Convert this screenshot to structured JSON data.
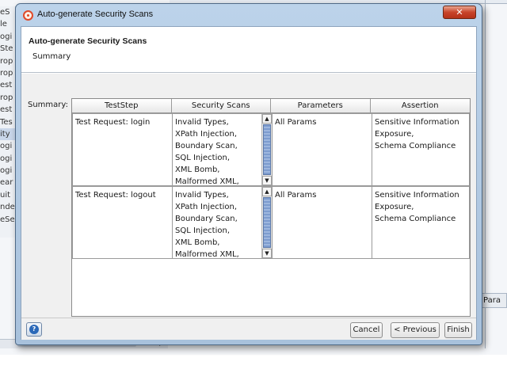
{
  "background": {
    "sidebar_fragments": [
      "eS",
      "le",
      "ogi",
      "Ste",
      "rop",
      "rop",
      "est",
      "rop",
      "est",
      "Tes",
      "ity",
      "ogi",
      "ogi",
      "ogi",
      "ear",
      "uit",
      "nde",
      "eSe"
    ],
    "tab_fragment": "Para"
  },
  "dialog": {
    "title": "Auto-generate Security Scans",
    "close_glyph": "✕",
    "header": {
      "title": "Auto-generate Security Scans",
      "subtitle": "Summary"
    },
    "summary_label": "Summary:",
    "table": {
      "columns": [
        "TestStep",
        "Security Scans",
        "Parameters",
        "Assertion"
      ],
      "rows": [
        {
          "teststep": "Test Request: login",
          "scans": "Invalid Types,\nXPath Injection,\nBoundary Scan,\nSQL Injection,\nXML Bomb,\nMalformed XML,",
          "parameters": "All Params",
          "assertion": "Sensitive Information\nExposure,\nSchema Compliance"
        },
        {
          "teststep": "Test Request: logout",
          "scans": "Invalid Types,\nXPath Injection,\nBoundary Scan,\nSQL Injection,\nXML Bomb,\nMalformed XML,",
          "parameters": "All Params",
          "assertion": "Sensitive Information\nExposure,\nSchema Compliance"
        }
      ]
    },
    "footer": {
      "help_glyph": "?",
      "cancel": "Cancel",
      "previous": "< Previous",
      "finish": "Finish"
    }
  },
  "colors": {
    "dialog_frame": "#a8c1dc",
    "close_button": "#c8442a",
    "scroll_thumb": "#7d9ccf"
  },
  "icons": [
    "app-icon",
    "close-icon",
    "help-icon",
    "scroll-up-icon",
    "scroll-down-icon"
  ]
}
